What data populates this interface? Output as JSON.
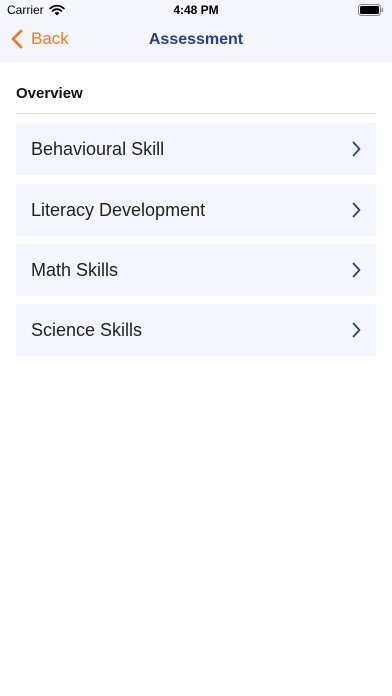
{
  "status_bar": {
    "carrier": "Carrier",
    "time": "4:48 PM"
  },
  "nav": {
    "back_label": "Back",
    "title": "Assessment"
  },
  "section": {
    "title": "Overview"
  },
  "items": [
    {
      "label": "Behavioural Skill"
    },
    {
      "label": "Literacy Development"
    },
    {
      "label": "Math Skills"
    },
    {
      "label": "Science Skills"
    }
  ],
  "colors": {
    "accent": "#f07a2c",
    "title": "#27418f",
    "row_background": "#f4f6fd",
    "chevron": "#27418f"
  }
}
